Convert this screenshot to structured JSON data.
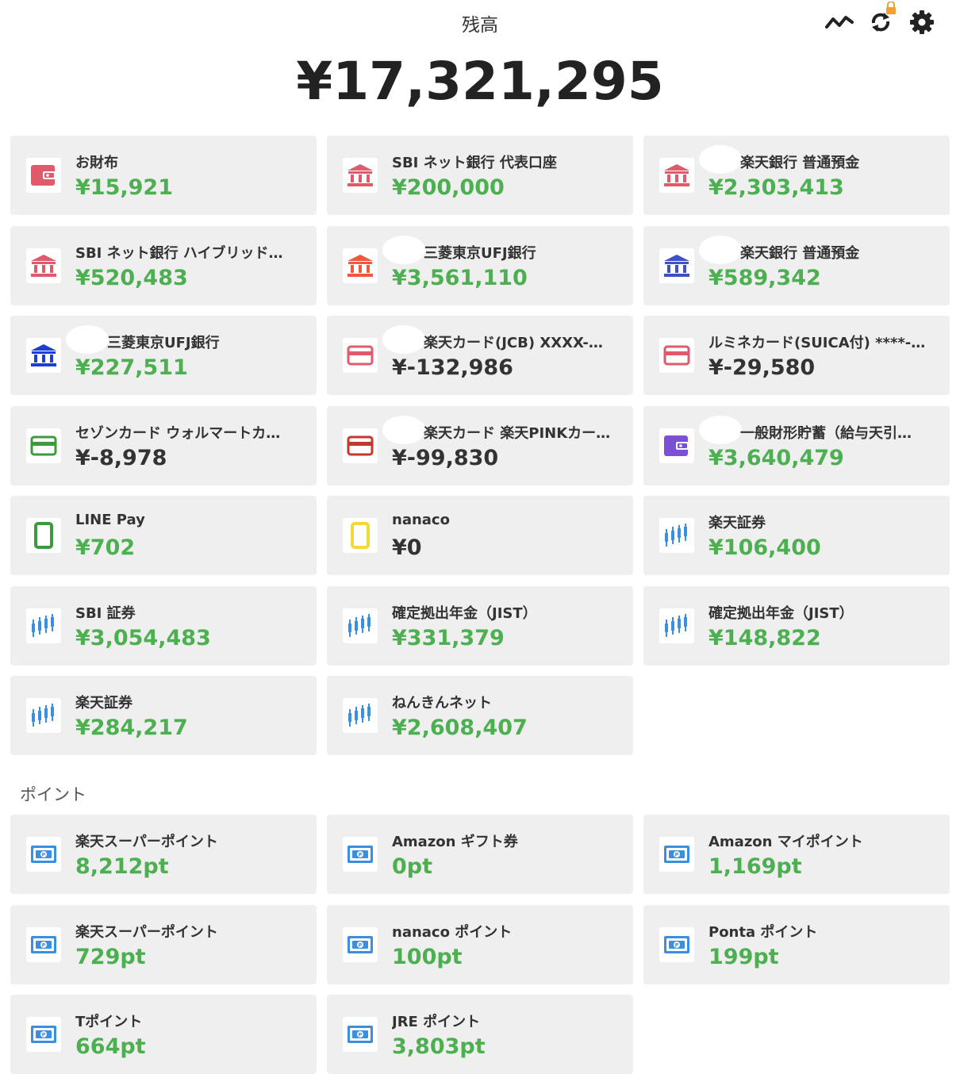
{
  "header": {
    "title": "残高",
    "total": "¥17,321,295",
    "icons": [
      "chart-line-icon",
      "sync-icon",
      "lock-icon",
      "gear-icon"
    ]
  },
  "colors": {
    "positive": "#4caf50",
    "negative": "#333333",
    "card_bg": "#efefef"
  },
  "accounts": [
    {
      "name": "お財布",
      "amount": "¥15,921",
      "sign": "pos",
      "icon": "wallet-icon",
      "icon_color": "#e05a6b"
    },
    {
      "name": "SBI ネット銀行 代表口座",
      "amount": "¥200,000",
      "sign": "pos",
      "icon": "bank-icon",
      "icon_color": "#e05a6b"
    },
    {
      "name": "楽天銀行 普通預金",
      "amount": "¥2,303,413",
      "sign": "pos",
      "icon": "bank-icon",
      "icon_color": "#e05a6b",
      "pad": true
    },
    {
      "name": "SBI ネット銀行 ハイブリッド…",
      "amount": "¥520,483",
      "sign": "pos",
      "icon": "bank-icon",
      "icon_color": "#e05a6b"
    },
    {
      "name": "三菱東京UFJ銀行",
      "amount": "¥3,561,110",
      "sign": "pos",
      "icon": "bank-icon",
      "icon_color": "#ef5a3c",
      "pad": true
    },
    {
      "name": "楽天銀行 普通預金",
      "amount": "¥589,342",
      "sign": "pos",
      "icon": "bank-icon",
      "icon_color": "#3f51c8",
      "pad": true
    },
    {
      "name": "三菱東京UFJ銀行",
      "amount": "¥227,511",
      "sign": "pos",
      "icon": "bank-icon",
      "icon_color": "#1a3fd6",
      "pad": true
    },
    {
      "name": "楽天カード(JCB) XXXX-…",
      "amount": "¥-132,986",
      "sign": "neg",
      "icon": "credit-card-icon",
      "icon_color": "#e05a6b",
      "pad": true
    },
    {
      "name": "ルミネカード(SUICA付) ****-…",
      "amount": "¥-29,580",
      "sign": "neg",
      "icon": "credit-card-icon",
      "icon_color": "#e05a6b"
    },
    {
      "name": "セゾンカード ウォルマートカ…",
      "amount": "¥-8,978",
      "sign": "neg",
      "icon": "credit-card-icon",
      "icon_color": "#3c9a3c"
    },
    {
      "name": "楽天カード 楽天PINKカー…",
      "amount": "¥-99,830",
      "sign": "neg",
      "icon": "credit-card-icon",
      "icon_color": "#c0392b",
      "pad": true
    },
    {
      "name": "一般財形貯蓄（給与天引…",
      "amount": "¥3,640,479",
      "sign": "pos",
      "icon": "wallet-icon",
      "icon_color": "#7b4fd6",
      "pad": true
    },
    {
      "name": "LINE Pay",
      "amount": "¥702",
      "sign": "pos",
      "icon": "phone-icon",
      "icon_color": "#3c9a3c"
    },
    {
      "name": "nanaco",
      "amount": "¥0",
      "sign": "neg",
      "icon": "phone-icon",
      "icon_color": "#f4d83a"
    },
    {
      "name": "楽天証券",
      "amount": "¥106,400",
      "sign": "pos",
      "icon": "stock-chart-icon",
      "icon_color": "#3a8fe0"
    },
    {
      "name": "SBI 証券",
      "amount": "¥3,054,483",
      "sign": "pos",
      "icon": "stock-chart-icon",
      "icon_color": "#3a8fe0"
    },
    {
      "name": "確定拠出年金（JIST）",
      "amount": "¥331,379",
      "sign": "pos",
      "icon": "stock-chart-icon",
      "icon_color": "#3a8fe0"
    },
    {
      "name": "確定拠出年金（JIST）",
      "amount": "¥148,822",
      "sign": "pos",
      "icon": "stock-chart-icon",
      "icon_color": "#3a8fe0"
    },
    {
      "name": "楽天証券",
      "amount": "¥284,217",
      "sign": "pos",
      "icon": "stock-chart-icon",
      "icon_color": "#3a8fe0"
    },
    {
      "name": "ねんきんネット",
      "amount": "¥2,608,407",
      "sign": "pos",
      "icon": "stock-chart-icon",
      "icon_color": "#3a8fe0"
    }
  ],
  "points_section": {
    "label": "ポイント",
    "items": [
      {
        "name": "楽天スーパーポイント",
        "amount": "8,212pt",
        "icon": "point-card-icon"
      },
      {
        "name": "Amazon ギフト券",
        "amount": "0pt",
        "icon": "point-card-icon"
      },
      {
        "name": "Amazon マイポイント",
        "amount": "1,169pt",
        "icon": "point-card-icon"
      },
      {
        "name": "楽天スーパーポイント",
        "amount": "729pt",
        "icon": "point-card-icon"
      },
      {
        "name": "nanaco ポイント",
        "amount": "100pt",
        "icon": "point-card-icon"
      },
      {
        "name": "Ponta ポイント",
        "amount": "199pt",
        "icon": "point-card-icon"
      },
      {
        "name": "Tポイント",
        "amount": "664pt",
        "icon": "point-card-icon"
      },
      {
        "name": "JRE ポイント",
        "amount": "3,803pt",
        "icon": "point-card-icon"
      }
    ]
  }
}
